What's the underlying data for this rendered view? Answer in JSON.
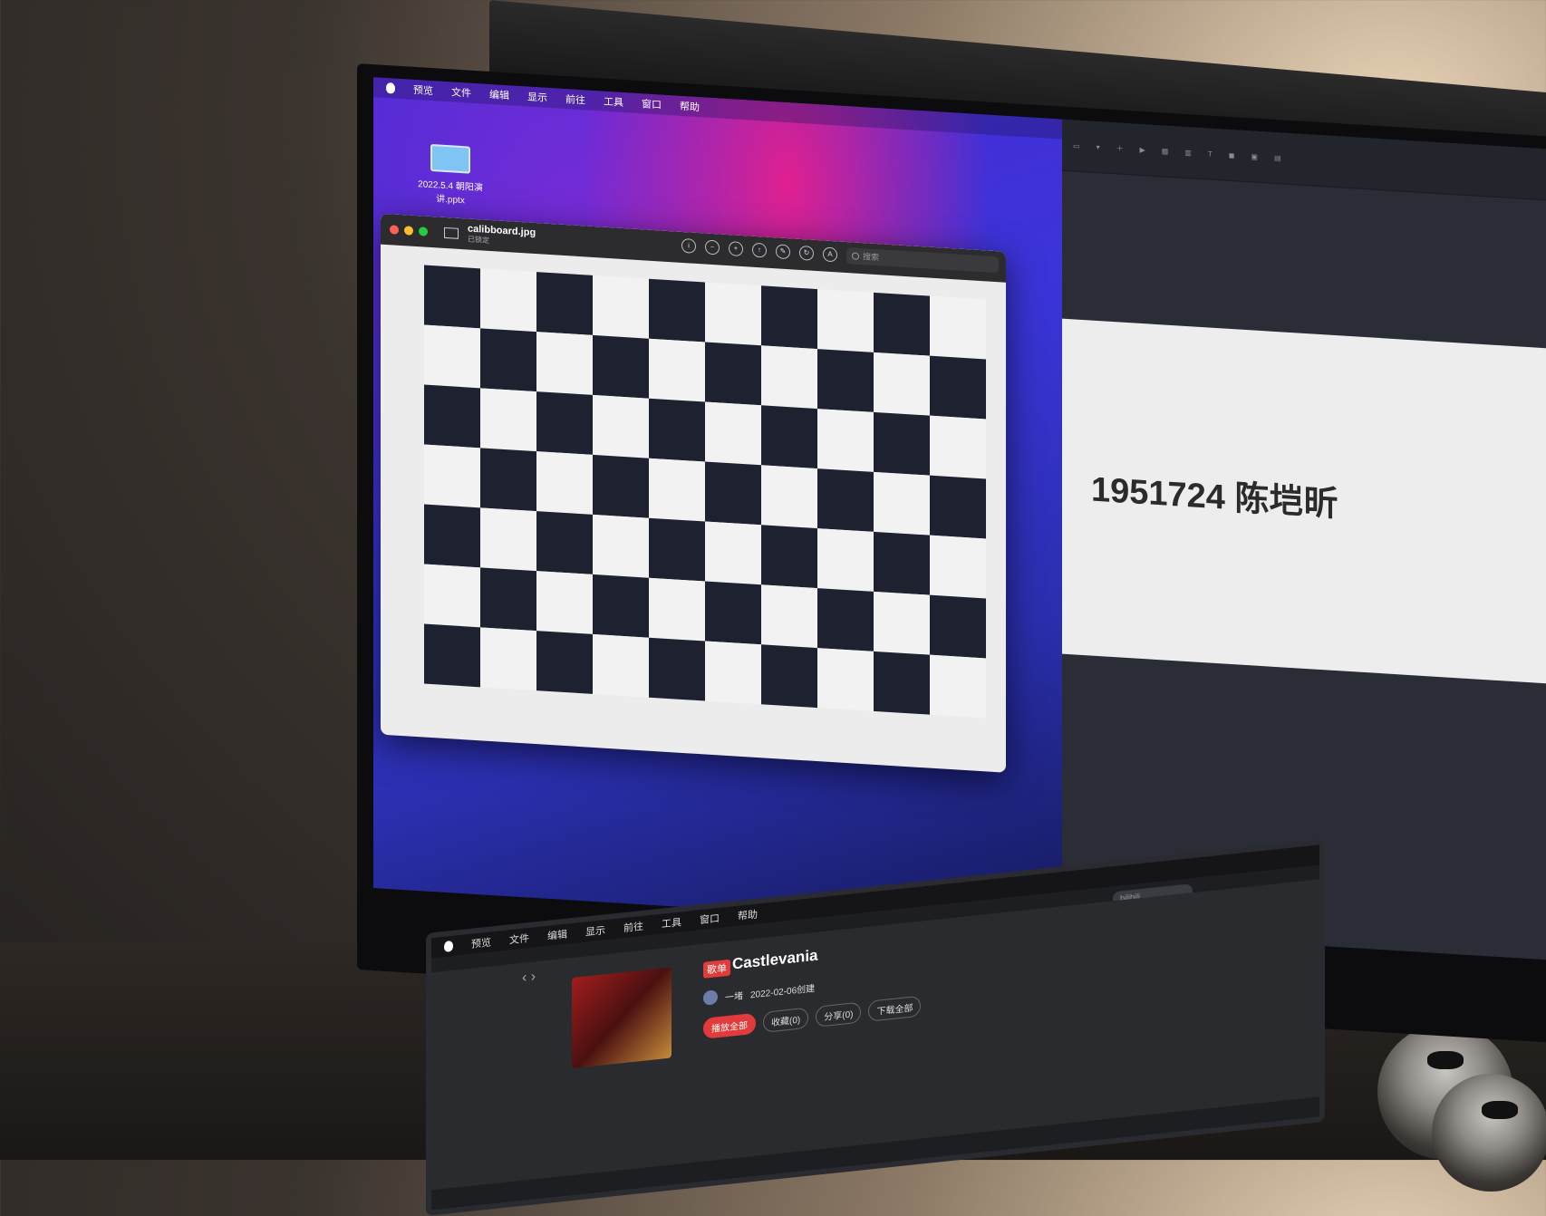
{
  "left_menubar": {
    "items": [
      "预览",
      "文件",
      "编辑",
      "显示",
      "前往",
      "工具",
      "窗口",
      "帮助"
    ]
  },
  "desktop_file": {
    "name": "2022.5.4 朝阳演讲.pptx"
  },
  "preview_window": {
    "filename": "calibboard.jpg",
    "status": "已锁定",
    "search_placeholder": "搜索"
  },
  "checkerboard": {
    "rows": 7,
    "cols": 10
  },
  "keynote": {
    "slide_text": "1951724 陈垲昕"
  },
  "laptop": {
    "menubar_items": [
      "预览",
      "文件",
      "编辑",
      "显示",
      "前往",
      "工具",
      "窗口",
      "帮助"
    ],
    "search_value": "bilibili",
    "playlist": {
      "tag": "歌单",
      "title": "Castlevania",
      "creator": "一堵",
      "date": "2022-02-06创建",
      "play_all": "播放全部",
      "favorite": "收藏(0)",
      "share": "分享(0)",
      "download_all": "下载全部"
    }
  }
}
